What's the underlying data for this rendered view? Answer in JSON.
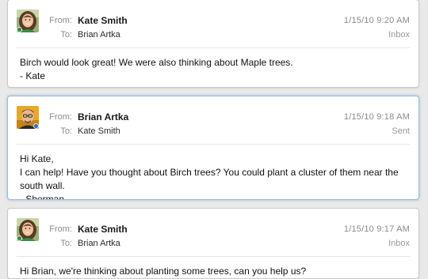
{
  "labels": {
    "from": "From:",
    "to": "To:"
  },
  "messages": [
    {
      "from": "Kate Smith",
      "to": "Brian Artka",
      "date": "1/15/10 9:20 AM",
      "mailbox": "Inbox",
      "avatar": "kate-avatar",
      "body_lines": [
        "Birch would look great!  We were also thinking about Maple trees.",
        "- Kate"
      ]
    },
    {
      "from": "Brian Artka",
      "to": "Kate Smith",
      "date": "1/15/10 9:18 AM",
      "mailbox": "Sent",
      "avatar": "brian-avatar",
      "selected": true,
      "body_lines": [
        "Hi Kate,",
        "I can help!  Have you thought about Birch trees?  You could plant a cluster of them near the south wall.",
        "- Sherman"
      ]
    },
    {
      "from": "Kate Smith",
      "to": "Brian Artka",
      "date": "1/15/10 9:17 AM",
      "mailbox": "Inbox",
      "avatar": "kate-avatar",
      "body_lines": [
        "Hi Brian, we're thinking about planting some trees, can you help us?"
      ]
    }
  ],
  "colors": {
    "background": "#e9e9e9",
    "card": "#ffffff",
    "selected_border": "#9dbcdc",
    "meta_text": "#8a8a8a"
  }
}
